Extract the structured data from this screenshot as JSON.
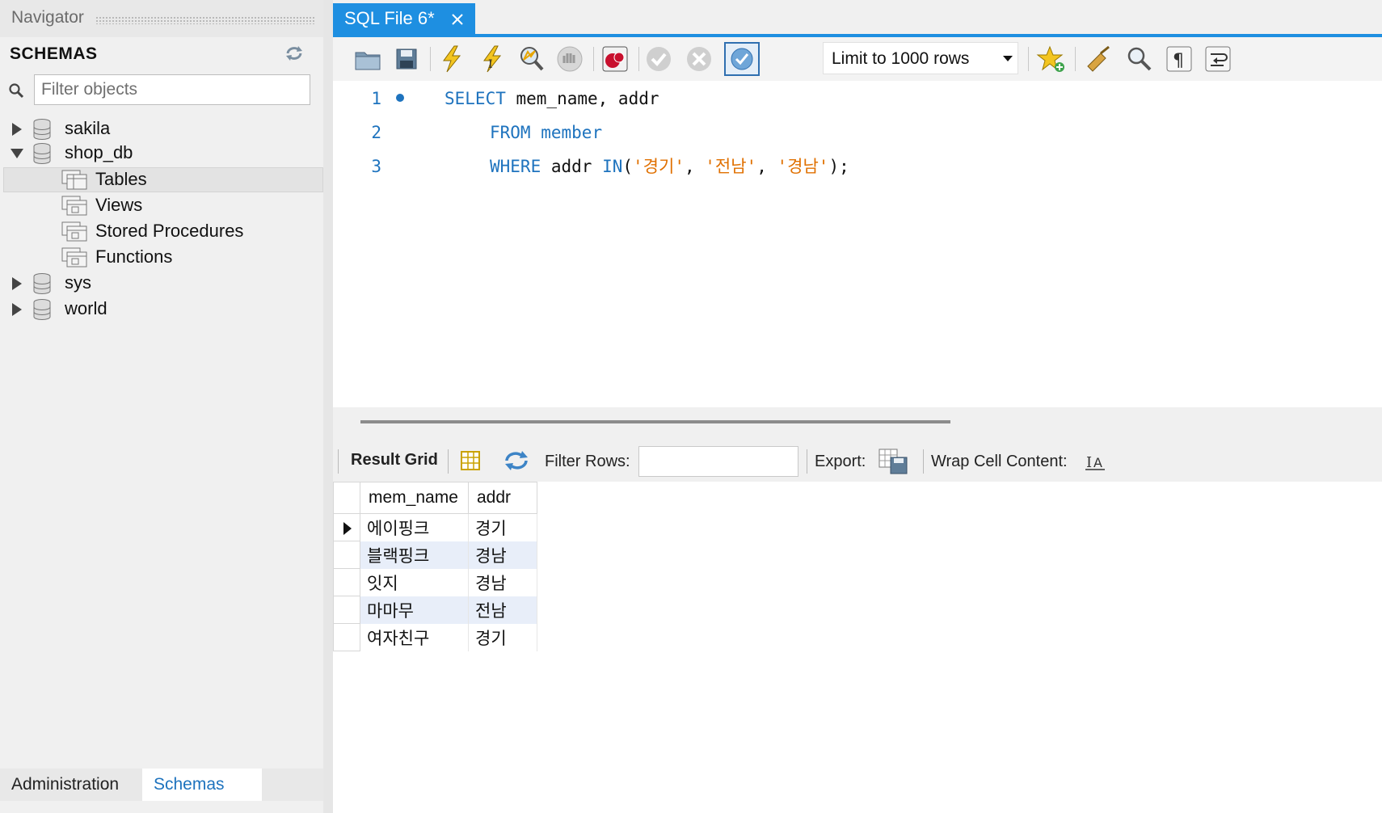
{
  "navigator": {
    "title": "Navigator",
    "schemas_title": "SCHEMAS",
    "filter_placeholder": "Filter objects",
    "schemas": [
      {
        "name": "sakila",
        "expanded": false
      },
      {
        "name": "shop_db",
        "expanded": true,
        "children": [
          "Tables",
          "Views",
          "Stored Procedures",
          "Functions"
        ]
      },
      {
        "name": "sys",
        "expanded": false
      },
      {
        "name": "world",
        "expanded": false
      }
    ],
    "selected_item": "Tables",
    "bottom_tabs": [
      "Administration",
      "Schemas"
    ],
    "active_bottom_tab": "Schemas"
  },
  "editor": {
    "tab_label": "SQL File 6*",
    "limit_label": "Limit to 1000 rows",
    "code_lines": [
      {
        "no": "1",
        "parts": [
          [
            "kw",
            "SELECT"
          ],
          [
            "id",
            " mem_name, addr"
          ]
        ]
      },
      {
        "no": "2",
        "parts": [
          [
            "kw",
            "FROM"
          ],
          [
            "id",
            " "
          ],
          [
            "kw",
            "member"
          ]
        ]
      },
      {
        "no": "3",
        "parts": [
          [
            "kw",
            "WHERE"
          ],
          [
            "id",
            " addr "
          ],
          [
            "kw",
            "IN"
          ],
          [
            "id",
            "("
          ],
          [
            "str",
            "'경기'"
          ],
          [
            "id",
            ", "
          ],
          [
            "str",
            "'전남'"
          ],
          [
            "id",
            ", "
          ],
          [
            "str",
            "'경남'"
          ],
          [
            "id",
            ");"
          ]
        ]
      }
    ]
  },
  "result": {
    "tab_label": "Result Grid",
    "filter_rows_label": "Filter Rows:",
    "export_label": "Export:",
    "wrap_label": "Wrap Cell Content:",
    "columns": [
      "mem_name",
      "addr"
    ],
    "rows": [
      [
        "에이핑크",
        "경기"
      ],
      [
        "블랙핑크",
        "경남"
      ],
      [
        "잇지",
        "경남"
      ],
      [
        "마마무",
        "전남"
      ],
      [
        "여자친구",
        "경기"
      ]
    ]
  },
  "colors": {
    "accent": "#1e8fe1",
    "keyword": "#1e73be",
    "string": "#e07000",
    "alt_row": "#e8eef9"
  }
}
